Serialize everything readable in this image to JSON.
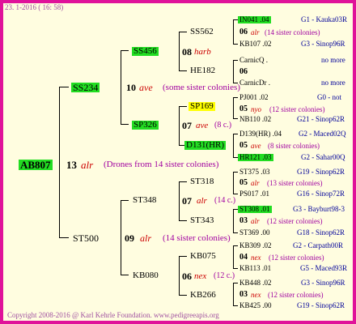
{
  "header": "23.  1-2016 ( 16: 58)",
  "footer": "Copyright 2008-2016 @ Karl Kehrle Foundation.   www.pedigreeapis.org",
  "g1": {
    "id": "AB807",
    "num": "13",
    "name": "alr",
    "note": "(Drones from 14 sister colonies)"
  },
  "g2": [
    {
      "id": "SS234",
      "num": "10",
      "name": "ave",
      "note": "(some sister colonies)"
    },
    {
      "id": "ST500",
      "num": "09",
      "name": "alr",
      "note": "(14 sister colonies)"
    }
  ],
  "g3": [
    {
      "id": "SS456",
      "num": "08",
      "name": "harb",
      "note": ""
    },
    {
      "id": "SP326",
      "num": "07",
      "name": "ave",
      "note": "(8 c.)"
    },
    {
      "id": "ST348",
      "num": "07",
      "name": "alr",
      "note": "(14 c.)"
    },
    {
      "id": "KB080",
      "num": "06",
      "name": "nex",
      "note": "(12 c.)"
    }
  ],
  "g4": [
    {
      "id": "SS562",
      "num": "",
      "name": "",
      "note": ""
    },
    {
      "id": "HE182",
      "num": "",
      "name": "",
      "note": ""
    },
    {
      "id": "SP169",
      "num": "",
      "name": "",
      "note": ""
    },
    {
      "id": "D131(HR)",
      "num": "",
      "name": "",
      "note": ""
    },
    {
      "id": "ST318",
      "num": "",
      "name": "",
      "note": ""
    },
    {
      "id": "ST343",
      "num": "",
      "name": "",
      "note": ""
    },
    {
      "id": "KB075",
      "num": "",
      "name": "",
      "note": ""
    },
    {
      "id": "KB266",
      "num": "",
      "name": "",
      "note": ""
    }
  ],
  "g5": [
    {
      "a": "IN041 .04",
      "b": "",
      "c": "G1 - Kauka03R"
    },
    {
      "a": "06",
      "b": "alr",
      "c": "(14 sister colonies)"
    },
    {
      "a": "KB107 .02",
      "b": "",
      "c": "G3 - Sinop96R"
    },
    {
      "a": "CarnicQ .",
      "b": "",
      "c": "no more"
    },
    {
      "a": "06",
      "b": "",
      "c": ""
    },
    {
      "a": "CarnicDr .",
      "b": "",
      "c": "no more"
    },
    {
      "a": "PJ001 .02",
      "b": "",
      "c": "G0 - not"
    },
    {
      "a": "05",
      "b": "nyo",
      "c": "(12 sister colonies)"
    },
    {
      "a": "NB110 .02",
      "b": "",
      "c": "G21 - Sinop62R"
    },
    {
      "a": "D139(HR) .04",
      "b": "",
      "c": "G2 - Maced02Q"
    },
    {
      "a": "05",
      "b": "ave",
      "c": "(8 sister colonies)"
    },
    {
      "a": "HR121 .03",
      "b": "",
      "c": "G2 - Sahar00Q"
    },
    {
      "a": "ST375 .03",
      "b": "",
      "c": "G19 - Sinop62R"
    },
    {
      "a": "05",
      "b": "alr",
      "c": "(13 sister colonies)"
    },
    {
      "a": "PS017 .01",
      "b": "",
      "c": "G16 - Sinop72R"
    },
    {
      "a": "ST308 .01",
      "b": "",
      "c": "G3 - Bayburt98-3"
    },
    {
      "a": "03",
      "b": "alr",
      "c": "(12 sister colonies)"
    },
    {
      "a": "ST369 .00",
      "b": "",
      "c": "G18 - Sinop62R"
    },
    {
      "a": "KB309 .02",
      "b": "",
      "c": "G2 - Carpath00R"
    },
    {
      "a": "04",
      "b": "nex",
      "c": "(12 sister colonies)"
    },
    {
      "a": "KB113 .01",
      "b": "",
      "c": "G5 - Maced93R"
    },
    {
      "a": "KB448 .02",
      "b": "",
      "c": "G3 - Sinop96R"
    },
    {
      "a": "03",
      "b": "nex",
      "c": "(12 sister colonies)"
    },
    {
      "a": "KB425 .00",
      "b": "",
      "c": "G19 - Sinop62R"
    }
  ]
}
